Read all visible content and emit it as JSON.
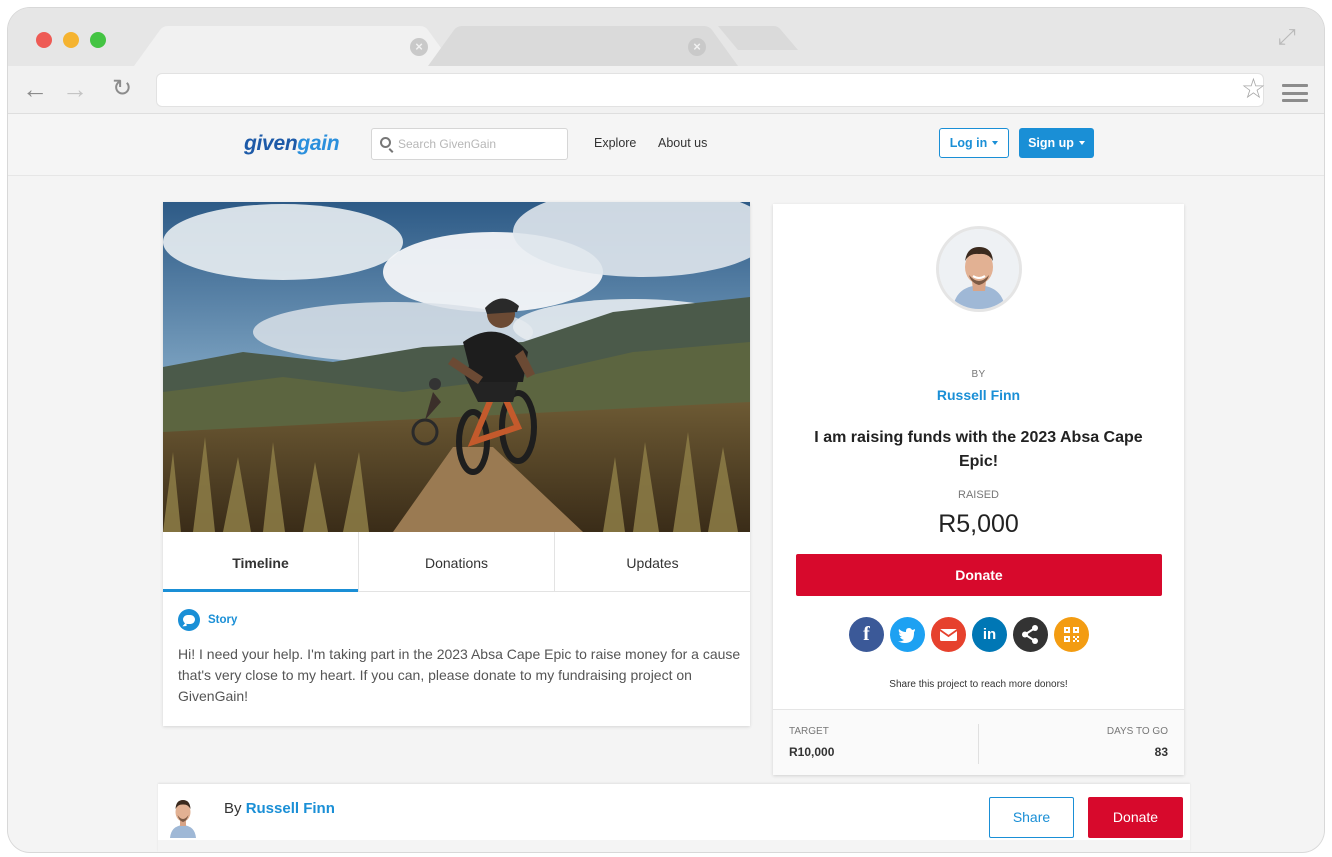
{
  "browser": {
    "tabs": [
      {
        "label": "",
        "active": true
      },
      {
        "label": "",
        "active": false
      }
    ],
    "address": ""
  },
  "header": {
    "logo": {
      "part1": "given",
      "part2": "gain"
    },
    "search_placeholder": "Search GivenGain",
    "nav": [
      "Explore",
      "About us"
    ],
    "login_label": "Log in",
    "signup_label": "Sign up"
  },
  "tabs": [
    "Timeline",
    "Donations",
    "Updates"
  ],
  "active_tab": "Timeline",
  "story": {
    "label": "Story",
    "text": "Hi! I need your help. I'm taking part in the 2023 Absa Cape Epic to raise money for a cause that's very close to my heart. If you can, please donate to my fundraising project on GivenGain!"
  },
  "project": {
    "by_label": "BY",
    "author": "Russell Finn",
    "title": "I am raising funds with the 2023 Absa Cape Epic!",
    "raised_label": "RAISED",
    "raised_amount": "R5,000",
    "donate_label": "Donate",
    "social_icons": [
      "facebook-icon",
      "twitter-icon",
      "email-icon",
      "linkedin-icon",
      "share-icon",
      "qr-code-icon"
    ],
    "share_hint": "Share this project to reach more donors!",
    "target_label": "TARGET",
    "target_value": "R10,000",
    "days_label": "DAYS TO GO",
    "days_value": "83"
  },
  "bottom_bar": {
    "by_prefix": "By",
    "author": "Russell Finn",
    "share_label": "Share",
    "donate_label": "Donate"
  },
  "colors": {
    "brand_blue": "#1a8fd6",
    "logo_dark_blue": "#1d5aa8",
    "donate_red": "#d7092c"
  }
}
